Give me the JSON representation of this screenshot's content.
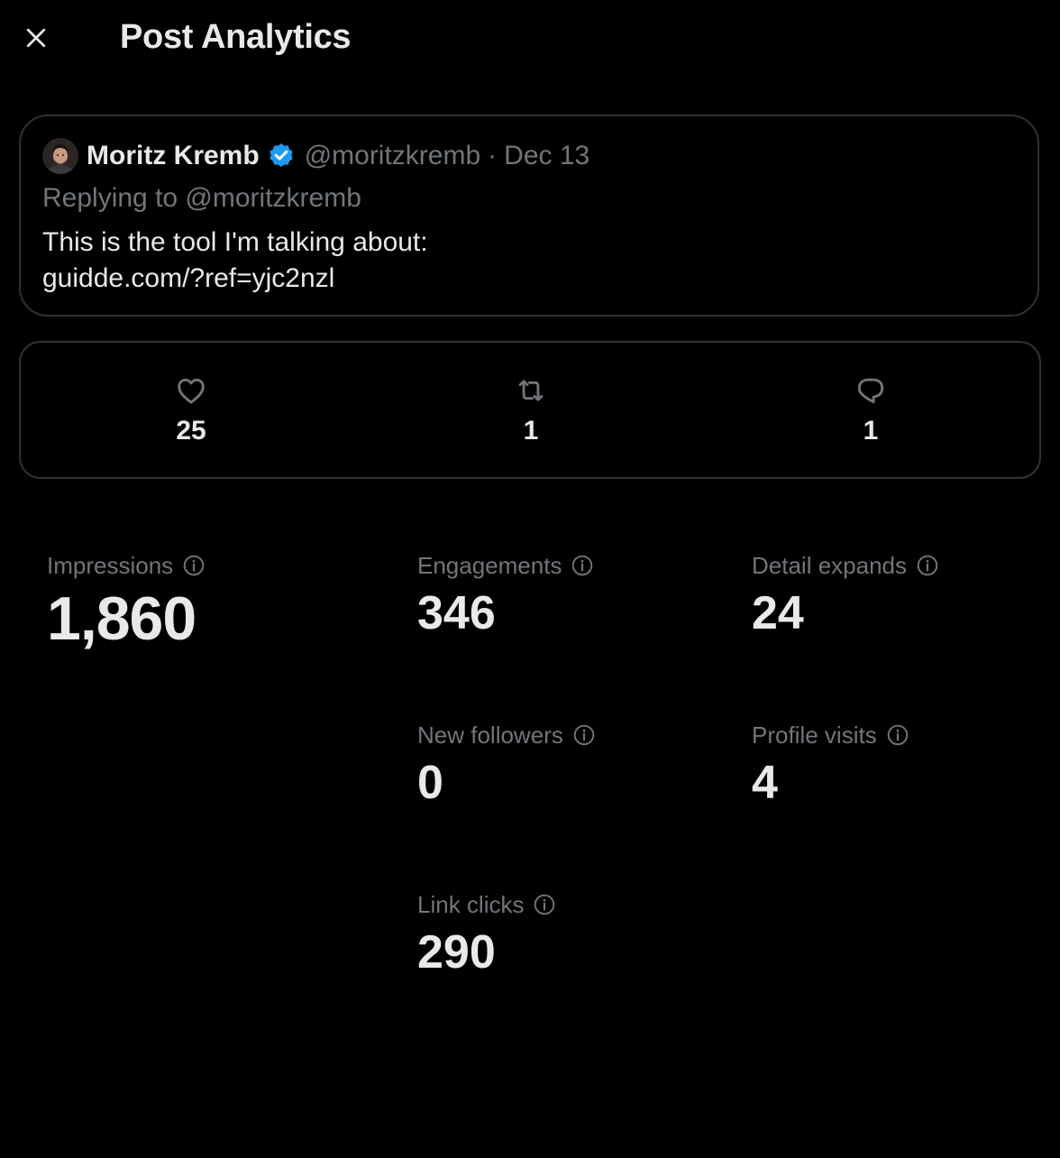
{
  "header": {
    "title": "Post Analytics",
    "close_icon": "close-icon"
  },
  "post": {
    "author_name": "Moritz Kremb",
    "verified_icon": "verified-badge-icon",
    "handle": "@moritzkremb",
    "separator": "·",
    "date": "Dec 13",
    "replying_to": "Replying to @moritzkremb",
    "text": "This is the tool I'm talking about:",
    "link": "guidde.com/?ref=yjc2nzl"
  },
  "counts": {
    "likes": {
      "icon": "heart-icon",
      "value": "25"
    },
    "reposts": {
      "icon": "repost-icon",
      "value": "1"
    },
    "replies": {
      "icon": "reply-icon",
      "value": "1"
    }
  },
  "metrics": {
    "impressions": {
      "label": "Impressions",
      "value": "1,860"
    },
    "engagements": {
      "label": "Engagements",
      "value": "346"
    },
    "detail_expands": {
      "label": "Detail expands",
      "value": "24"
    },
    "new_followers": {
      "label": "New followers",
      "value": "0"
    },
    "profile_visits": {
      "label": "Profile visits",
      "value": "4"
    },
    "link_clicks": {
      "label": "Link clicks",
      "value": "290"
    }
  },
  "colors": {
    "background": "#000000",
    "text_primary": "#e7e9ea",
    "text_secondary": "#71767b",
    "border": "#2f3336",
    "verified": "#1d9bf0"
  }
}
